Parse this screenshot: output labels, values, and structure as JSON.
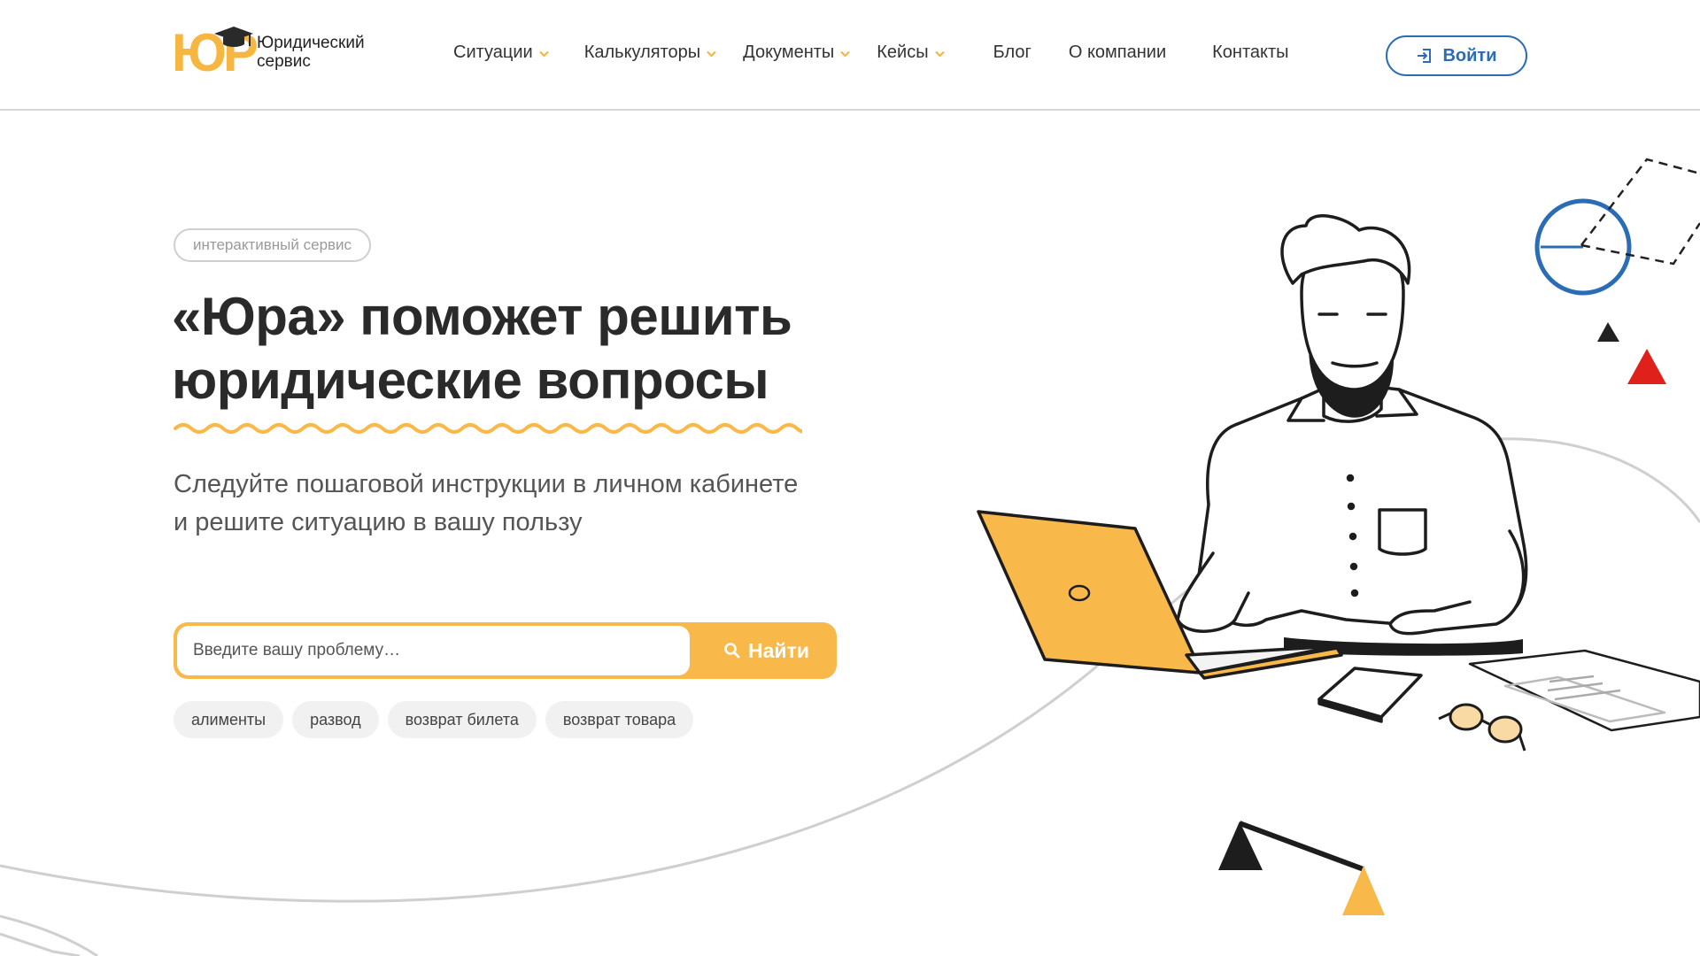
{
  "logo": {
    "mark": "ЮР",
    "line1": "Юридический",
    "line2": "сервис"
  },
  "nav": {
    "items": [
      {
        "label": "Ситуации",
        "dropdown": true
      },
      {
        "label": "Калькуляторы",
        "dropdown": true
      },
      {
        "label": "Документы",
        "dropdown": true
      },
      {
        "label": "Кейсы",
        "dropdown": true
      },
      {
        "label": "Блог",
        "dropdown": false
      },
      {
        "label": "О компании",
        "dropdown": false
      },
      {
        "label": "Контакты",
        "dropdown": false
      }
    ],
    "login_label": "Войти"
  },
  "hero": {
    "badge": "интерактивный сервис",
    "title_line1": "«Юра» поможет решить",
    "title_line2": "юридические вопросы",
    "subtitle_line1": "Следуйте пошаговой инструкции в личном кабинете",
    "subtitle_line2": "и решите ситуацию в вашу пользу"
  },
  "search": {
    "placeholder": "Введите вашу проблему…",
    "value": "",
    "button_label": "Найти"
  },
  "tags": [
    "алименты",
    "развод",
    "возврат билета",
    "возврат товара"
  ],
  "colors": {
    "accent_yellow": "#f9b84a",
    "accent_blue": "#2a6db5",
    "accent_red": "#e0201b",
    "text_dark": "#2a2a2a"
  },
  "icons": {
    "nav_chevron": "chevron-down-icon",
    "login": "login-icon",
    "search": "search-icon"
  }
}
